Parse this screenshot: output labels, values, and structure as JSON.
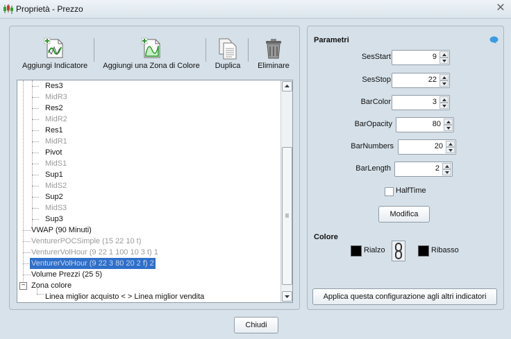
{
  "window": {
    "title": "Proprietà - Prezzo"
  },
  "toolbar": {
    "add_indicator": "Aggiungi Indicatore",
    "add_color_zone": "Aggiungi una Zona di Colore",
    "duplicate": "Duplica",
    "delete": "Eliminare"
  },
  "tree": {
    "items": [
      {
        "label": "Res3",
        "style": "black"
      },
      {
        "label": "MidR3",
        "style": "gray"
      },
      {
        "label": "Res2",
        "style": "black"
      },
      {
        "label": "MidR2",
        "style": "gray"
      },
      {
        "label": "Res1",
        "style": "black"
      },
      {
        "label": "MidR1",
        "style": "gray"
      },
      {
        "label": "Pivot",
        "style": "black"
      },
      {
        "label": "MidS1",
        "style": "gray"
      },
      {
        "label": "Sup1",
        "style": "black"
      },
      {
        "label": "MidS2",
        "style": "gray"
      },
      {
        "label": "Sup2",
        "style": "black"
      },
      {
        "label": "MidS3",
        "style": "gray"
      },
      {
        "label": "Sup3",
        "style": "black"
      },
      {
        "label": "VWAP (90 Minuti)",
        "style": "black"
      },
      {
        "label": "VenturerPOCSimple (15 22 10 t)",
        "style": "gray"
      },
      {
        "label": "VenturerVolHour (9 22 1 100 10 3 t) 1",
        "style": "gray"
      },
      {
        "label": "VenturerVolHour (9 22 3 80 20 2 f) 2",
        "style": "selected"
      },
      {
        "label": "Volume Prezzi (25 5)",
        "style": "black"
      },
      {
        "label": "Zona colore",
        "style": "black"
      },
      {
        "label": "Linea miglior acquisto < > Linea miglior vendita",
        "style": "black"
      }
    ],
    "collapse_symbol": "−"
  },
  "params": {
    "title": "Parametri",
    "fields": [
      {
        "label": "SesStart",
        "value": "9"
      },
      {
        "label": "SesStop",
        "value": "22"
      },
      {
        "label": "BarColor",
        "value": "3"
      },
      {
        "label": "BarOpacity",
        "value": "80"
      },
      {
        "label": "BarNumbers",
        "value": "20"
      },
      {
        "label": "BarLength",
        "value": "2"
      }
    ],
    "halftime_label": "HalfTime",
    "halftime_checked": false,
    "modify_button": "Modifica"
  },
  "colors": {
    "title": "Colore",
    "rise_label": "Rialzo",
    "fall_label": "Ribasso",
    "rise_color": "#000000",
    "fall_color": "#000000"
  },
  "apply_button": "Applica questa configurazione agli altri indicatori",
  "close_button": "Chiudi",
  "icons": {
    "app": "candlestick-icon",
    "close": "close-icon",
    "help": "help-bubble-icon",
    "link": "chain-link-icon"
  },
  "accent_color": "#2f6fc9"
}
